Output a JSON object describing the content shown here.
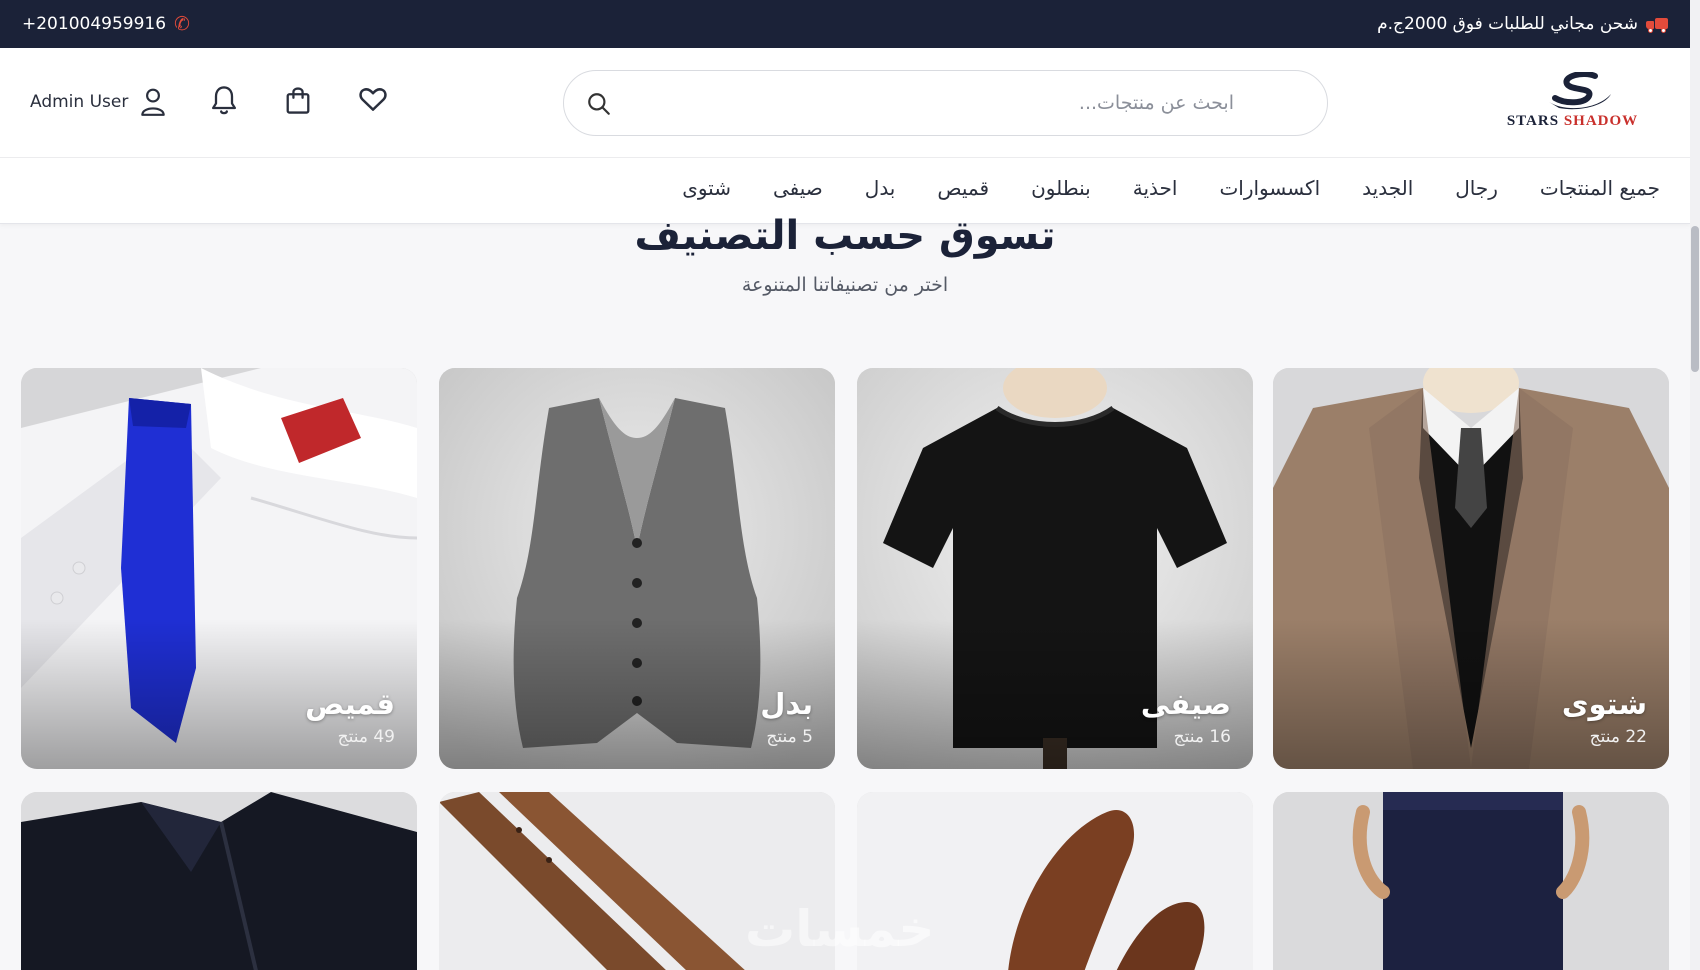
{
  "topbar": {
    "promo_text": "شحن مجاني للطلبات فوق 2000ج.م",
    "phone": "+201004959916"
  },
  "header": {
    "logo_text_1": "STARS",
    "logo_text_2": "SHADOW",
    "search_placeholder": "ابحث عن منتجات...",
    "user_name": "Admin User"
  },
  "nav": {
    "items": [
      "شتوى",
      "صيفى",
      "بدل",
      "قميص",
      "بنطلون",
      "احذية",
      "اكسسوارات",
      "الجديد",
      "رجال",
      "جميع المنتجات"
    ]
  },
  "section": {
    "title": "تسوق حسب التصنيف",
    "subtitle": "اختر من تصنيفاتنا المتنوعة"
  },
  "categories": [
    {
      "name": "شتوى",
      "count": "22 منتج"
    },
    {
      "name": "صيفى",
      "count": "16 منتج"
    },
    {
      "name": "بدل",
      "count": "5 منتج"
    },
    {
      "name": "قميص",
      "count": "49 منتج"
    }
  ],
  "watermark": "خمسات",
  "colors": {
    "topbar_bg": "#1b2238",
    "accent_red": "#e24b3b"
  }
}
